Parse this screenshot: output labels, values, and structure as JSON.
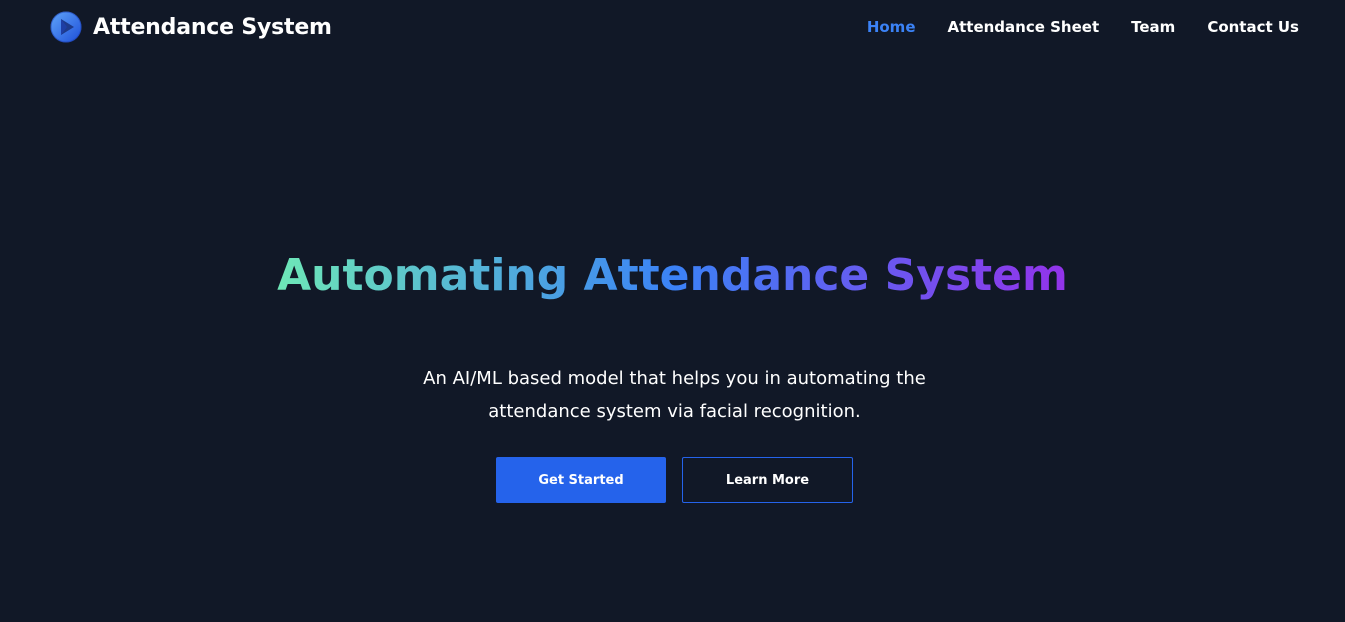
{
  "brand": {
    "name": "Attendance System",
    "logo_icon": "play-circle-logo-icon"
  },
  "nav": {
    "items": [
      {
        "label": "Home",
        "active": true
      },
      {
        "label": "Attendance Sheet",
        "active": false
      },
      {
        "label": "Team",
        "active": false
      },
      {
        "label": "Contact Us",
        "active": false
      }
    ]
  },
  "hero": {
    "title": "Automating Attendance System",
    "subtitle": "An AI/ML based model that helps you in automating the attendance system via facial recognition.",
    "primary_button": "Get Started",
    "secondary_button": "Learn More"
  },
  "colors": {
    "background": "#111827",
    "accent": "#2563eb",
    "active_link": "#3b82f6",
    "gradient_start": "#6ee7b7",
    "gradient_mid": "#3b82f6",
    "gradient_end": "#9333ea"
  }
}
